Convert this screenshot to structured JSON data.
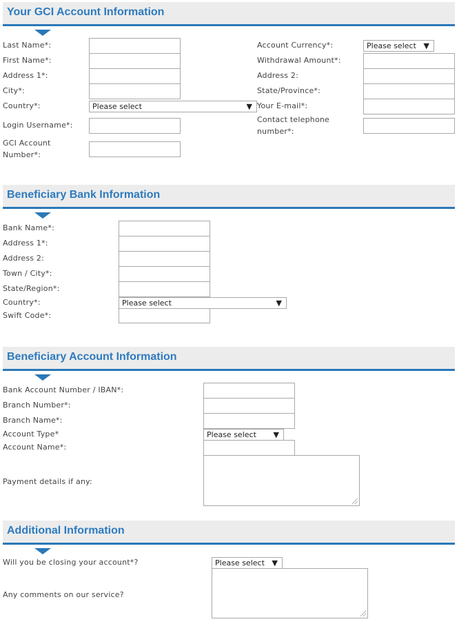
{
  "sections": {
    "account": {
      "title": "Your GCI Account Information",
      "fields": {
        "last_name": "Last Name*:",
        "first_name": "First Name*:",
        "address1": "Address 1*:",
        "city": "City*:",
        "country": "Country*:",
        "login_username": "Login Username*:",
        "gci_account_number": "GCI Account Number*:",
        "account_currency": "Account Currency*:",
        "withdrawal_amount": "Withdrawal Amount*:",
        "address2": "Address 2:",
        "state_province": "State/Province*:",
        "email": "Your E-mail*:",
        "contact_phone": "Contact telephone number*:"
      },
      "country_value": "Please select",
      "currency_value": "Please select"
    },
    "bank": {
      "title": "Beneficiary Bank Information",
      "fields": {
        "bank_name": "Bank Name*:",
        "address1": "Address 1*:",
        "address2": "Address 2:",
        "town_city": "Town / City*:",
        "state_region": "State/Region*:",
        "country": "Country*:",
        "swift_code": "Swift Code*:"
      },
      "country_value": "Please select"
    },
    "beneficiary_account": {
      "title": "Beneficiary Account Information",
      "fields": {
        "account_number": "Bank Account Number / IBAN*:",
        "branch_number": "Branch Number*:",
        "branch_name": "Branch Name*:",
        "account_type": "Account Type*",
        "account_name": "Account Name*:",
        "payment_details": "Payment details if any:"
      },
      "account_type_value": "Please select"
    },
    "additional": {
      "title": "Additional Information",
      "fields": {
        "closing_account": "Will you be closing your account*?",
        "comments": "Any comments on our service?"
      },
      "closing_value": "Please select"
    }
  },
  "icons": {
    "dropdown_arrow": "▼"
  },
  "colors": {
    "accent": "#2a78b8",
    "header_bg": "#ececec",
    "title": "#2e7bbf"
  }
}
